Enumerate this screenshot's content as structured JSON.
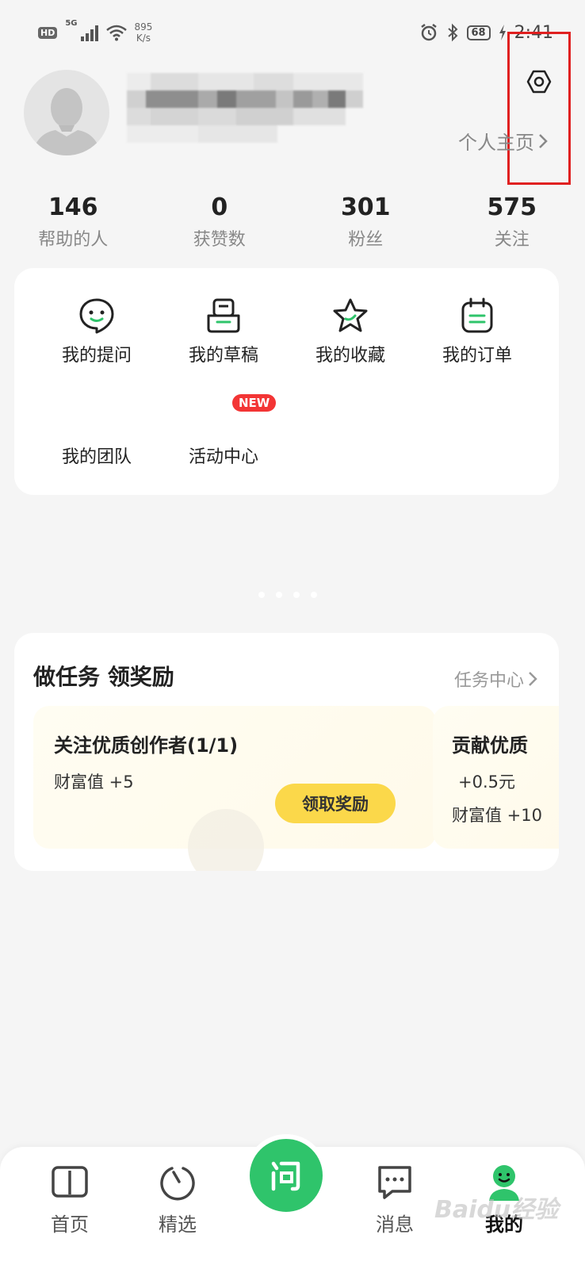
{
  "status_bar": {
    "hd": "HD",
    "network": "5G",
    "speed_value": "895",
    "speed_unit": "K/s",
    "battery": "68",
    "time": "2:41"
  },
  "profile": {
    "home_link": "个人主页",
    "stats": [
      {
        "value": "146",
        "label": "帮助的人"
      },
      {
        "value": "0",
        "label": "获赞数"
      },
      {
        "value": "301",
        "label": "粉丝"
      },
      {
        "value": "575",
        "label": "关注"
      }
    ]
  },
  "features": {
    "items": [
      {
        "label": "我的提问",
        "icon": "smile-chat-icon"
      },
      {
        "label": "我的草稿",
        "icon": "draft-icon"
      },
      {
        "label": "我的收藏",
        "icon": "star-icon"
      },
      {
        "label": "我的订单",
        "icon": "order-icon"
      },
      {
        "label": "我的团队",
        "icon": ""
      },
      {
        "label": "活动中心",
        "icon": ""
      }
    ],
    "new_badge": "NEW"
  },
  "tasks": {
    "title": "做任务 领奖励",
    "link": "任务中心",
    "cards": [
      {
        "title": "关注优质创作者(1/1)",
        "reward1": "财富值 +5",
        "button": "领取奖励"
      },
      {
        "title": "贡献优质",
        "reward1": "+0.5元",
        "reward2": "财富值 +10"
      }
    ]
  },
  "nav": {
    "items": [
      {
        "label": "首页",
        "icon": "book-icon"
      },
      {
        "label": "精选",
        "icon": "circle-arc-icon"
      },
      {
        "label": "问",
        "icon": "ask-icon"
      },
      {
        "label": "消息",
        "icon": "message-icon"
      },
      {
        "label": "我的",
        "icon": "profile-icon",
        "active": true
      }
    ],
    "watermark": "Baidu经验"
  },
  "colors": {
    "accent_green": "#2fc46b",
    "badge_red": "#f33535",
    "claim_yellow": "#fbd84a",
    "highlight_red": "#e02020"
  }
}
